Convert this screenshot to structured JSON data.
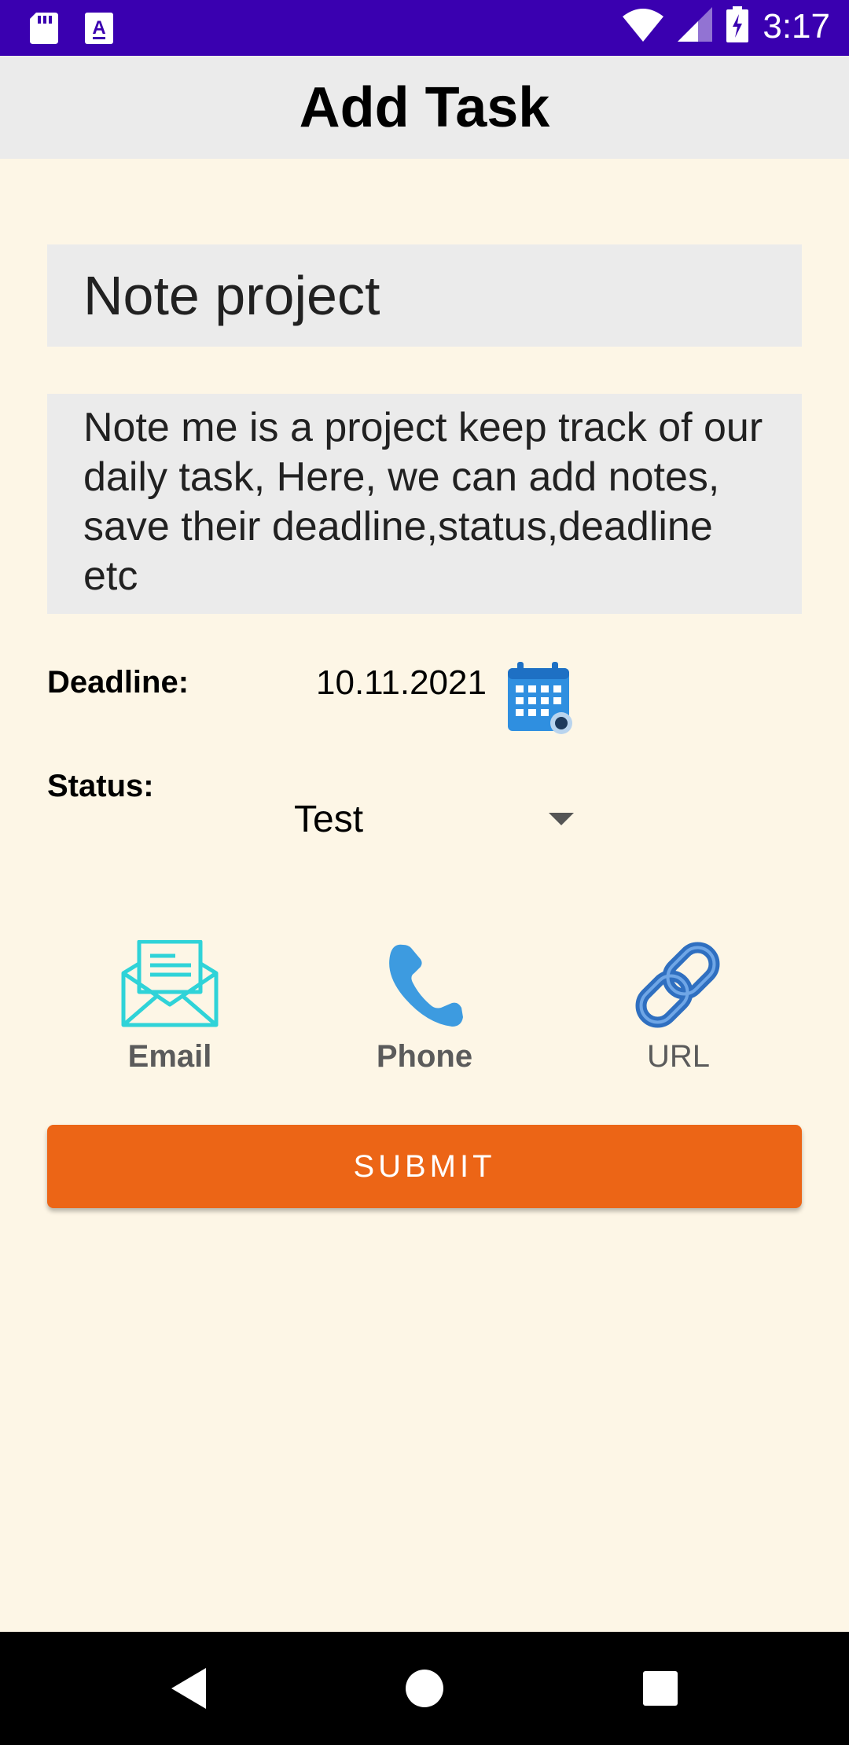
{
  "status_bar": {
    "time": "3:17",
    "icons": [
      "sd-card-icon",
      "a-notification-icon",
      "wifi-icon",
      "signal-icon",
      "battery-charging-icon"
    ]
  },
  "app_bar": {
    "title": "Add Task"
  },
  "form": {
    "title_value": "Note project",
    "description_value": "Note me is a project keep track of our daily task, Here, we can add notes, save their deadline,status,deadline etc",
    "deadline_label": "Deadline:",
    "deadline_value": "10.11.2021",
    "status_label": "Status:",
    "status_value": "Test"
  },
  "contacts": {
    "email_label": "Email",
    "phone_label": "Phone",
    "url_label": "URL"
  },
  "submit_label": "SUBMIT",
  "colors": {
    "status_bar": "#3a00b0",
    "app_bar": "#ebebeb",
    "background": "#fdf6e6",
    "submit": "#ec6516",
    "email_icon": "#2fd3d8",
    "phone_icon": "#3d9be0",
    "link_icon": "#2f6fc0"
  },
  "nav_bar": {
    "icons": [
      "back-icon",
      "home-icon",
      "recent-apps-icon"
    ]
  }
}
